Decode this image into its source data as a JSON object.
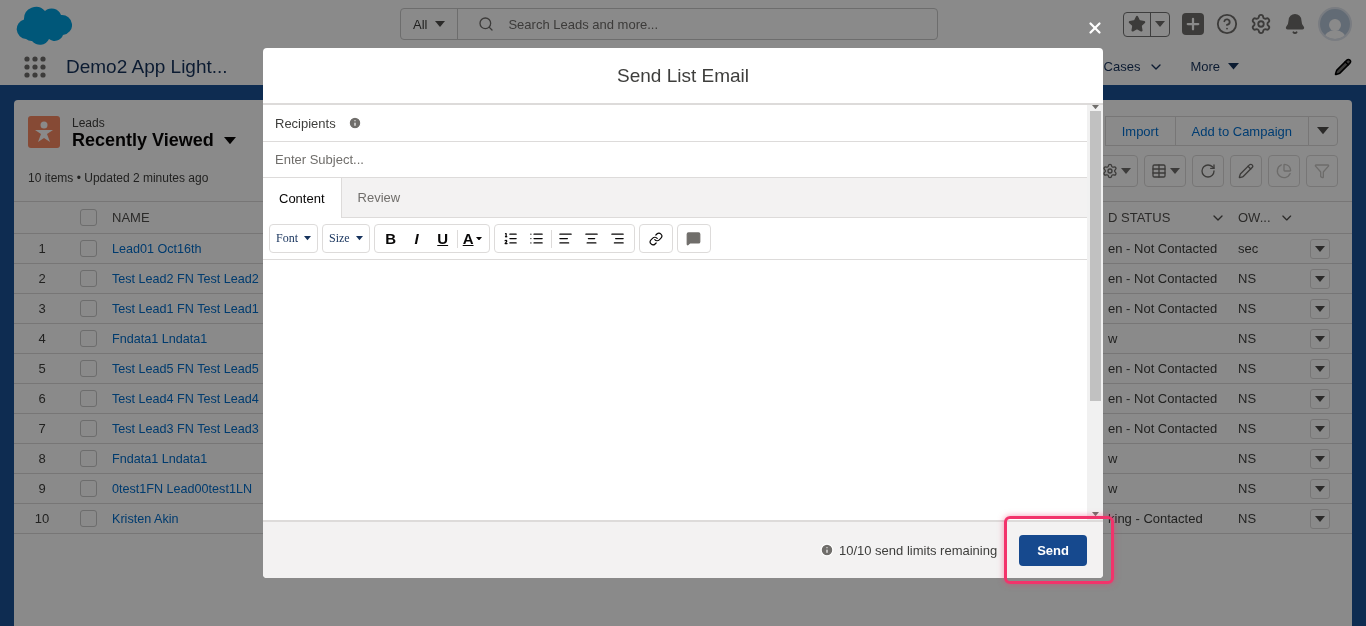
{
  "header": {
    "search_scope": "All",
    "search_placeholder": "Search Leads and more..."
  },
  "nav": {
    "app_name": "Demo2 App Light...",
    "items": [
      {
        "label": "Cases",
        "kind": "chevron"
      },
      {
        "label": "More",
        "kind": "caret"
      }
    ]
  },
  "list_view": {
    "object": "Leads",
    "title": "Recently Viewed",
    "meta": "10 items • Updated 2 minutes ago",
    "actions": [
      "Import",
      "Add to Campaign"
    ],
    "controls": [
      {
        "disabled": false
      },
      {
        "disabled": false
      },
      {
        "disabled": false
      },
      {
        "disabled": false
      },
      {
        "disabled": true
      },
      {
        "disabled": true
      }
    ]
  },
  "table": {
    "all_checked": false,
    "columns": [
      {
        "label": "NAME"
      },
      {
        "label": "D STATUS"
      },
      {
        "label": "OW..."
      }
    ],
    "rows": [
      {
        "number": "1",
        "checked": false,
        "name": "Lead01 Oct16th",
        "status": "en - Not Contacted",
        "owner": "sec"
      },
      {
        "number": "2",
        "checked": false,
        "name": "Test Lead2 FN Test Lead2",
        "status": "en - Not Contacted",
        "owner": "NS"
      },
      {
        "number": "3",
        "checked": false,
        "name": "Test Lead1 FN Test Lead1",
        "status": "en - Not Contacted",
        "owner": "NS"
      },
      {
        "number": "4",
        "checked": false,
        "name": "Fndata1 Lndata1",
        "status": "w",
        "owner": "NS"
      },
      {
        "number": "5",
        "checked": false,
        "name": "Test Lead5 FN Test Lead5",
        "status": "en - Not Contacted",
        "owner": "NS"
      },
      {
        "number": "6",
        "checked": false,
        "name": "Test Lead4 FN Test Lead4",
        "status": "en - Not Contacted",
        "owner": "NS"
      },
      {
        "number": "7",
        "checked": false,
        "name": "Test Lead3 FN Test Lead3",
        "status": "en - Not Contacted",
        "owner": "NS"
      },
      {
        "number": "8",
        "checked": false,
        "name": "Fndata1 Lndata1",
        "status": "w",
        "owner": "NS"
      },
      {
        "number": "9",
        "checked": false,
        "name": "0test1FN Lead00test1LN",
        "status": "w",
        "owner": "NS"
      },
      {
        "number": "10",
        "checked": false,
        "name": "Kristen Akin",
        "status": "king - Contacted",
        "owner": "NS"
      }
    ]
  },
  "modal": {
    "title": "Send List Email",
    "recipients_label": "Recipients",
    "subject_placeholder": "Enter Subject...",
    "tabs": [
      {
        "label": "Content",
        "selected": true
      },
      {
        "label": "Review",
        "selected": false
      }
    ],
    "selects": [
      "Font",
      "Size"
    ],
    "format_letters": [
      "B",
      "I",
      "U",
      "A"
    ],
    "limit_text": "10/10 send limits remaining",
    "send_label": "Send"
  }
}
